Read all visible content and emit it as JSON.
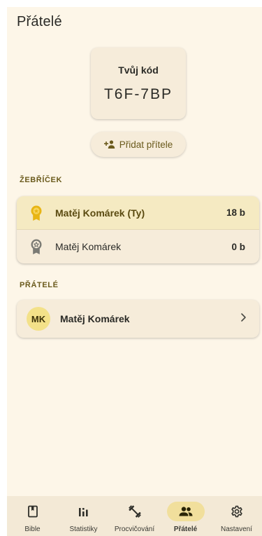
{
  "page": {
    "title": "Přátelé"
  },
  "code_card": {
    "label": "Tvůj kód",
    "value": "T6F-7BP"
  },
  "add_friend": {
    "label": "Přidat přítele",
    "icon": "person-add-icon"
  },
  "leaderboard": {
    "section_label": "ŽEBŘÍČEK",
    "rows": [
      {
        "name": "Matěj Komárek (Ty)",
        "points": "18 b",
        "medal": "gold-medal-icon",
        "highlight": true
      },
      {
        "name": "Matěj Komárek",
        "points": "0 b",
        "medal": "silver-medal-icon",
        "highlight": false
      }
    ]
  },
  "friends": {
    "section_label": "PŘÁTELÉ",
    "items": [
      {
        "initials": "MK",
        "name": "Matěj Komárek"
      }
    ]
  },
  "nav": {
    "items": [
      {
        "label": "Bible",
        "icon": "book-icon",
        "active": false
      },
      {
        "label": "Statistiky",
        "icon": "bar-chart-icon",
        "active": false
      },
      {
        "label": "Procvičování",
        "icon": "dumbbell-icon",
        "active": false
      },
      {
        "label": "Přátelé",
        "icon": "group-icon",
        "active": true
      },
      {
        "label": "Nastavení",
        "icon": "gear-icon",
        "active": false
      }
    ]
  },
  "colors": {
    "background": "#fdf6e8",
    "card": "#f6ecda",
    "highlight_row": "#f5eac2",
    "accent_text": "#6a5a1c",
    "gold_medal": "#e8b514",
    "silver_medal": "#7a7a74",
    "avatar": "#f3e189",
    "active_nav_pill": "#f1df9c"
  }
}
